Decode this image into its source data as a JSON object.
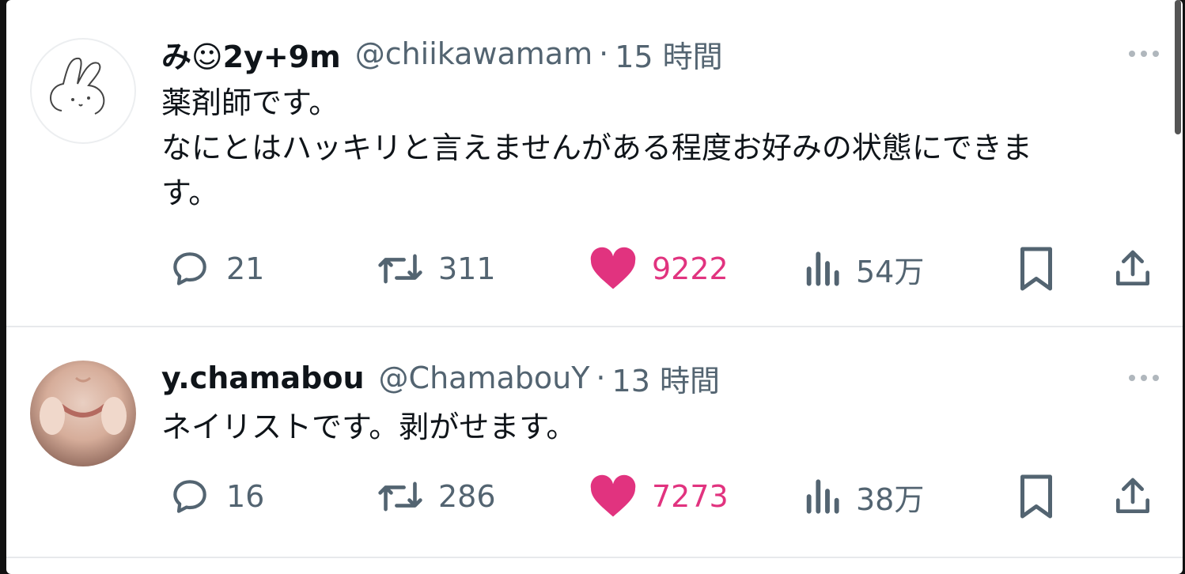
{
  "tweets": [
    {
      "name": "み☺2y+9m",
      "handle": "@chiikawamam",
      "separator": "·",
      "time": "15 時間",
      "lines": [
        "薬剤師です。",
        "なにとはハッキリと言えませんがある程度お好みの状態にできま",
        "す。"
      ],
      "replies": "21",
      "retweets": "311",
      "likes": "9222",
      "views": "54万",
      "avatar_icon": "bunny-doodle-icon"
    },
    {
      "name": "y.chamabou",
      "handle": "@ChamabouY",
      "separator": "·",
      "time": "13 時間",
      "lines": [
        "ネイリストです。剥がせます。"
      ],
      "replies": "16",
      "retweets": "286",
      "likes": "7273",
      "views": "38万",
      "avatar_icon": "face-photo-icon"
    }
  ],
  "colors": {
    "like": "#e1337f",
    "muted": "#536471",
    "text": "#0f1419"
  },
  "icons": [
    "reply-icon",
    "retweet-icon",
    "like-icon",
    "views-icon",
    "bookmark-icon",
    "share-icon",
    "more-icon"
  ]
}
